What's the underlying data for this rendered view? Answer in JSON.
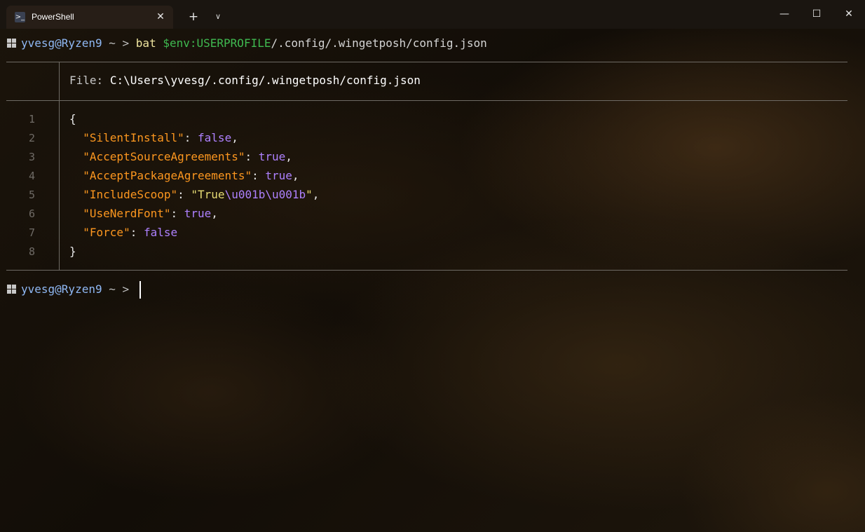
{
  "window": {
    "tab_title": "PowerShell",
    "tab_close_glyph": "✕",
    "new_tab_glyph": "+",
    "dropdown_glyph": "∨",
    "minimize_glyph": "—",
    "maximize_glyph": "☐",
    "close_glyph": "✕",
    "tab_icon": "powershell-icon"
  },
  "prompt": {
    "user_host": "yvesg@Ryzen9",
    "dir": "~",
    "chevron": ">"
  },
  "command": {
    "program": "bat",
    "variable": "$env:USERPROFILE",
    "path": "/.config/.wingetposh/config.json"
  },
  "bat": {
    "file_label": "File:",
    "file_path": "C:\\Users\\yvesg/.config/.wingetposh/config.json",
    "lines": [
      {
        "num": "1",
        "open": "{"
      },
      {
        "num": "2",
        "key": "\"SilentInstall\"",
        "value": "false",
        "trail": ","
      },
      {
        "num": "3",
        "key": "\"AcceptSourceAgreements\"",
        "value": "true",
        "trail": ","
      },
      {
        "num": "4",
        "key": "\"AcceptPackageAgreements\"",
        "value": "true",
        "trail": ","
      },
      {
        "num": "5",
        "key": "\"IncludeScoop\"",
        "str_open": "\"True",
        "esc1": "\\u001b",
        "esc2": "\\u001b",
        "str_close": "\"",
        "trail": ","
      },
      {
        "num": "6",
        "key": "\"UseNerdFont\"",
        "value": "true",
        "trail": ","
      },
      {
        "num": "7",
        "key": "\"Force\"",
        "value": "false",
        "trail": ""
      },
      {
        "num": "8",
        "close": "}"
      }
    ]
  },
  "colors": {
    "json_key": "#fd971f",
    "json_bool": "#ae81ff",
    "json_string": "#e6db74",
    "prompt_user": "#8fb8f4",
    "env_var": "#3fb950"
  }
}
